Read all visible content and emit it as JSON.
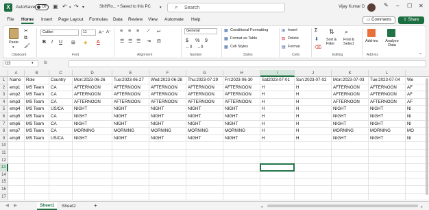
{
  "titlebar": {
    "autosave_label": "AutoSave",
    "autosave_state": "Off",
    "file_name": "ShiftRo... • Saved to this PC",
    "search_placeholder": "Search",
    "user_name": "Vijay Kumar D"
  },
  "menu_tabs": [
    "File",
    "Home",
    "Insert",
    "Page Layout",
    "Formulas",
    "Data",
    "Review",
    "View",
    "Automate",
    "Help"
  ],
  "active_tab": "Home",
  "buttons": {
    "comments": "Comments",
    "share": "Share"
  },
  "ribbon": {
    "clipboard": {
      "paste": "Paste",
      "label": "Clipboard"
    },
    "font": {
      "name": "Calibri",
      "size": "11",
      "label": "Font"
    },
    "alignment": {
      "label": "Alignment"
    },
    "number": {
      "format": "General",
      "label": "Number",
      "currency": "$",
      "percent": "%",
      "comma": "9"
    },
    "styles": {
      "conditional": "Conditional Formatting",
      "table": "Format as Table",
      "cell": "Cell Styles",
      "label": "Styles"
    },
    "cells": {
      "insert": "Insert",
      "delete": "Delete",
      "format": "Format",
      "label": "Cells"
    },
    "editing": {
      "sort": "Sort & Filter",
      "find": "Find & Select",
      "label": "Editing"
    },
    "addins": {
      "addins": "Add-ins",
      "analyze": "Analyze Data",
      "label": "Add-ins"
    }
  },
  "formula_bar": {
    "name_box": "I13",
    "fx": "fx",
    "formula": ""
  },
  "columns": [
    "A",
    "B",
    "C",
    "D",
    "E",
    "F",
    "G",
    "H",
    "I",
    "J",
    "K",
    "L",
    ""
  ],
  "rows": [
    "1",
    "2",
    "3",
    "4",
    "5",
    "6",
    "7",
    "8",
    "9",
    "10",
    "11",
    "12",
    "13",
    "14",
    "15",
    "16",
    "17"
  ],
  "table": [
    [
      "Name",
      "Role",
      "Country",
      "Mon:2023-06-26",
      "Tue:2023-06-27",
      "Wed:2023-06-28",
      "Thu:2023-07-29",
      "Fri:2023-06-30",
      "Sat2023-07-01",
      "Sun:2023-07-02",
      "Mon:2023-07-03",
      "Tue:2023-07-04",
      "We"
    ],
    [
      "emp1",
      "MS Team",
      "CA",
      "AFTERNOON",
      "AFTERNOON",
      "AFTERNOON",
      "AFTERNOON",
      "AFTERNOON",
      "H",
      "H",
      "AFTERNOON",
      "AFTERNOON",
      "AF"
    ],
    [
      "emp2",
      "MS Team",
      "CA",
      "AFTERNOON",
      "AFTERNOON",
      "AFTERNOON",
      "AFTERNOON",
      "AFTERNOON",
      "H",
      "H",
      "AFTERNOON",
      "AFTERNOON",
      "AF"
    ],
    [
      "emp3",
      "MS Team",
      "CA",
      "AFTERNOON",
      "AFTERNOON",
      "AFTERNOON",
      "AFTERNOON",
      "AFTERNOON",
      "H",
      "H",
      "AFTERNOON",
      "AFTERNOON",
      "AF"
    ],
    [
      "emp4",
      "MS Team",
      "US/CA",
      "NIGHT",
      "NIGHT",
      "NIGHT",
      "NIGHT",
      "NIGHT",
      "H",
      "H",
      "NIGHT",
      "NIGHT",
      "NI"
    ],
    [
      "emp5",
      "MS Team",
      "CA",
      "NIGHT",
      "NIGHT",
      "NIGHT",
      "NIGHT",
      "NIGHT",
      "H",
      "H",
      "NIGHT",
      "NIGHT",
      "NI"
    ],
    [
      "emp6",
      "MS Team",
      "CA",
      "NIGHT",
      "NIGHT",
      "NIGHT",
      "NIGHT",
      "NIGHT",
      "H",
      "H",
      "NIGHT",
      "NIGHT",
      "NI"
    ],
    [
      "emp7",
      "MS Team",
      "CA",
      "MORNING",
      "MORNING",
      "MORNING",
      "MORNING",
      "MORNING",
      "H",
      "H",
      "MORNING",
      "MORNING",
      "MO"
    ],
    [
      "emp8",
      "MS Team",
      "US/CA",
      "NIGHT",
      "NIGHT",
      "NIGHT",
      "NIGHT",
      "NIGHT",
      "H",
      "H",
      "NIGHT",
      "NIGHT",
      "NI"
    ]
  ],
  "sheets": [
    "Sheet1",
    "Sheet2"
  ],
  "add_sheet": "+",
  "colors": {
    "excel_green": "#1d6f42",
    "selection": "#217346"
  }
}
